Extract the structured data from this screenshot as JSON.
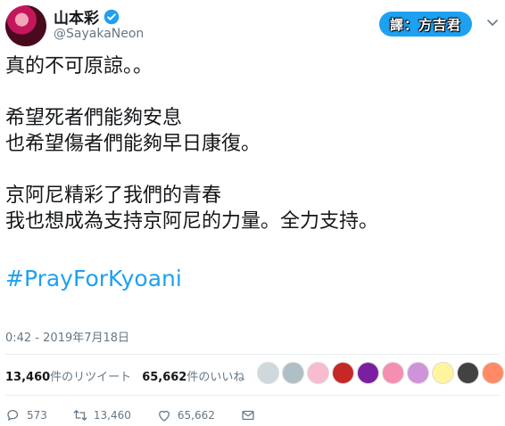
{
  "profile": {
    "display_name": "山本彩",
    "handle": "@SayakaNeon",
    "verified_icon": "verified-badge-icon"
  },
  "translator_badge": "譯：方吉君",
  "tweet": {
    "lines": [
      "真的不可原諒。。",
      "",
      "希望死者們能夠安息",
      "也希望傷者們能夠早日康復。",
      "",
      "京阿尼精彩了我們的青春",
      "我也想成為支持京阿尼的力量。全力支持。"
    ],
    "hashtag": "#PrayForKyoani",
    "timestamp": "0:42 - 2019年7月18日"
  },
  "stats": {
    "retweets_count": "13,460",
    "retweets_label": "件のリツイート",
    "likes_count": "65,662",
    "likes_label": "件のいいね"
  },
  "likers": [
    "#cfd8dc",
    "#b0bec5",
    "#f8bbd0",
    "#c62828",
    "#7b1fa2",
    "#f48fb1",
    "#ce93d8",
    "#fff59d",
    "#424242",
    "#ff8a65"
  ],
  "actions": {
    "reply_count": "573",
    "retweet_count": "13,460",
    "like_count": "65,662"
  },
  "colors": {
    "accent": "#1da1f2",
    "muted": "#657786"
  }
}
